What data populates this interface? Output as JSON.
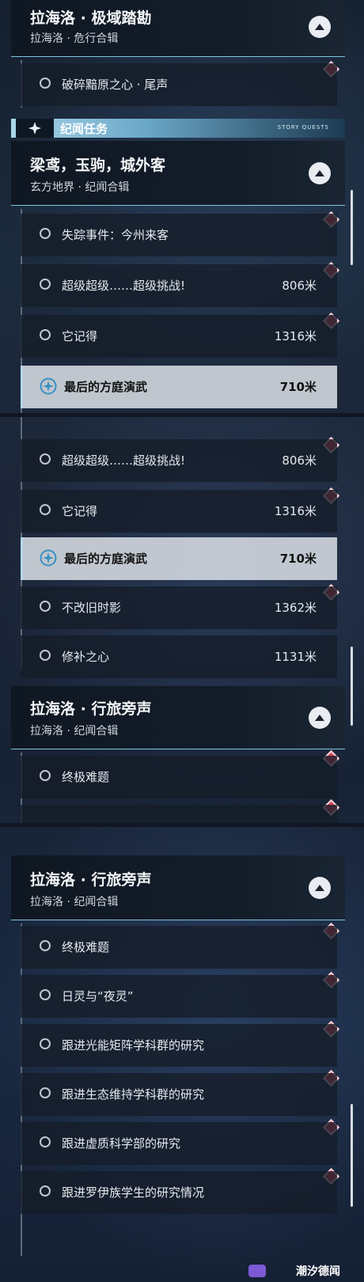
{
  "panel1": {
    "group_a": {
      "title": "拉海洛 · 极域踏勘",
      "subtitle": "拉海洛 · 危行合辑"
    },
    "row_a1": {
      "name": "破碎黯原之心 · 尾声"
    },
    "section": {
      "label": "纪闻任务",
      "tiny": "STORY QUESTS"
    },
    "group_b": {
      "title": "梁鸢，玉驹，城外客",
      "subtitle": "玄方地界 · 纪闻合辑"
    },
    "rows": [
      {
        "name": "失踪事件：今州来客",
        "dist": ""
      },
      {
        "name": "超级超级……超级挑战!",
        "dist": "806米"
      },
      {
        "name": "它记得",
        "dist": "1316米"
      },
      {
        "name": "最后的方庭演武",
        "dist": "710米"
      }
    ]
  },
  "panel2": {
    "rows": [
      {
        "name": "超级超级……超级挑战!",
        "dist": "806米"
      },
      {
        "name": "它记得",
        "dist": "1316米"
      },
      {
        "name": "最后的方庭演武",
        "dist": "710米"
      },
      {
        "name": "不改旧时影",
        "dist": "1362米"
      },
      {
        "name": "修补之心",
        "dist": "1131米"
      }
    ],
    "group_c": {
      "title": "拉海洛 · 行旅旁声",
      "subtitle": "拉海洛 · 纪闻合辑"
    },
    "row_c1": {
      "name": "终极难题"
    }
  },
  "panel3": {
    "group_c": {
      "title": "拉海洛 · 行旅旁声",
      "subtitle": "拉海洛 · 纪闻合辑"
    },
    "rows": [
      {
        "name": "终极难题"
      },
      {
        "name": "日灵与“夜灵”"
      },
      {
        "name": "跟进光能矩阵学科群的研究"
      },
      {
        "name": "跟进生态维持学科群的研究"
      },
      {
        "name": "跟进虚质科学部的研究"
      },
      {
        "name": "跟进罗伊族学生的研究情况"
      }
    ],
    "watermark": "潮汐德闻"
  },
  "colors": {
    "accent": "#7fc6e0",
    "marker": "#d9465e",
    "active_row": "#d7dce2"
  },
  "icons": {
    "collapse": "chevron-up-icon",
    "marker": "red-diamond-icon",
    "tracking": "compass-target-icon",
    "status": "circle-icon"
  }
}
